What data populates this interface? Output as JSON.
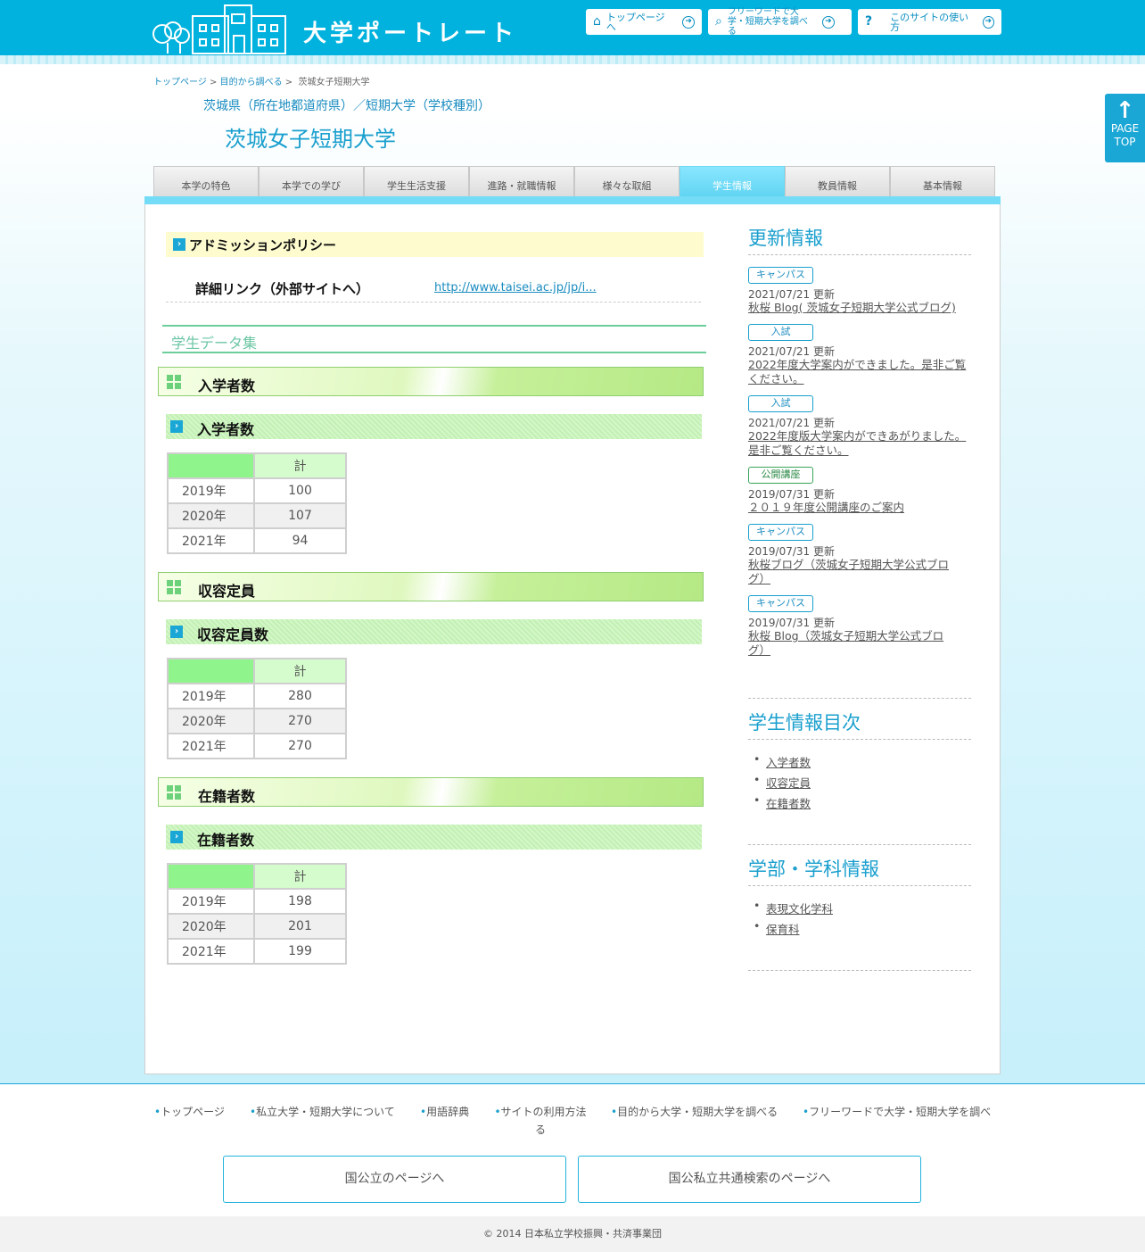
{
  "header": {
    "site_title": "大学ポートレート",
    "buttons": [
      {
        "label": "トップページへ",
        "icon": "home-icon"
      },
      {
        "label": "フリーワードで大学・短期大学を調べる",
        "icon": "search-icon"
      },
      {
        "label": "このサイトの使い方",
        "icon": "question-icon"
      }
    ]
  },
  "page_top": {
    "line1": "PAGE",
    "line2": "TOP"
  },
  "breadcrumb": {
    "home": "トップページ",
    "purpose": "目的から調べる",
    "current": "茨城女子短期大学",
    "sep": ">"
  },
  "prefecture_line": "茨城県（所在地都道府県）／短期大学（学校種別）",
  "university_name": "茨城女子短期大学",
  "tabs": [
    "本学の特色",
    "本学での学び",
    "学生生活支援",
    "進路・就職情報",
    "様々な取組",
    "学生情報",
    "教員情報",
    "基本情報"
  ],
  "active_tab": "学生情報",
  "admission": {
    "title": "アドミッションポリシー",
    "detail_label": "詳細リンク（外部サイトへ）",
    "detail_url": "http://www.taisei.ac.jp/jp/i..."
  },
  "data_heading": "学生データ集",
  "sections": [
    {
      "title": "入学者数",
      "sub": "入学者数",
      "col": "計",
      "rows": [
        {
          "year": "2019年",
          "value": "100"
        },
        {
          "year": "2020年",
          "value": "107"
        },
        {
          "year": "2021年",
          "value": "94"
        }
      ]
    },
    {
      "title": "収容定員",
      "sub": "収容定員数",
      "col": "計",
      "rows": [
        {
          "year": "2019年",
          "value": "280"
        },
        {
          "year": "2020年",
          "value": "270"
        },
        {
          "year": "2021年",
          "value": "270"
        }
      ]
    },
    {
      "title": "在籍者数",
      "sub": "在籍者数",
      "col": "計",
      "rows": [
        {
          "year": "2019年",
          "value": "198"
        },
        {
          "year": "2020年",
          "value": "201"
        },
        {
          "year": "2021年",
          "value": "199"
        }
      ]
    }
  ],
  "sidebar": {
    "updates_title": "更新情報",
    "updates": [
      {
        "tag": "キャンパス",
        "date": "2021/07/21 更新",
        "title": "秋桜 Blog( 茨城女子短期大学公式ブログ)"
      },
      {
        "tag": "入試",
        "date": "2021/07/21 更新",
        "title": "2022年度大学案内ができました。是非ご覧ください。"
      },
      {
        "tag": "入試",
        "date": "2021/07/21 更新",
        "title": "2022年度版大学案内ができあがりました。是非ご覧ください。"
      },
      {
        "tag": "公開講座",
        "date": "2019/07/31 更新",
        "title": "２０１９年度公開講座のご案内"
      },
      {
        "tag": "キャンパス",
        "date": "2019/07/31 更新",
        "title": "秋桜ブログ（茨城女子短期大学公式ブログ）"
      },
      {
        "tag": "キャンパス",
        "date": "2019/07/31 更新",
        "title": "秋桜 Blog（茨城女子短期大学公式ブログ）"
      }
    ],
    "toc_title": "学生情報目次",
    "toc": [
      "入学者数",
      "収容定員",
      "在籍者数"
    ],
    "dept_title": "学部・学科情報",
    "depts": [
      "表現文化学科",
      "保育科"
    ]
  },
  "footer": {
    "nav": [
      "トップページ",
      "私立大学・短期大学について",
      "用語辞典",
      "サイトの利用方法る",
      "目的から大学・短期大学を調べる",
      "フリーワードで大学・短期大学を調べ"
    ],
    "box_national": "国公立のページへ",
    "box_common": "国公私立共通検索のページへ",
    "copyright": "© 2014 日本私立学校振興・共済事業団"
  },
  "colors": {
    "brand": "#00b2dd",
    "accent": "#1a9fce",
    "tab_active": "#5fd4f2",
    "green_header": "#90f48c"
  }
}
